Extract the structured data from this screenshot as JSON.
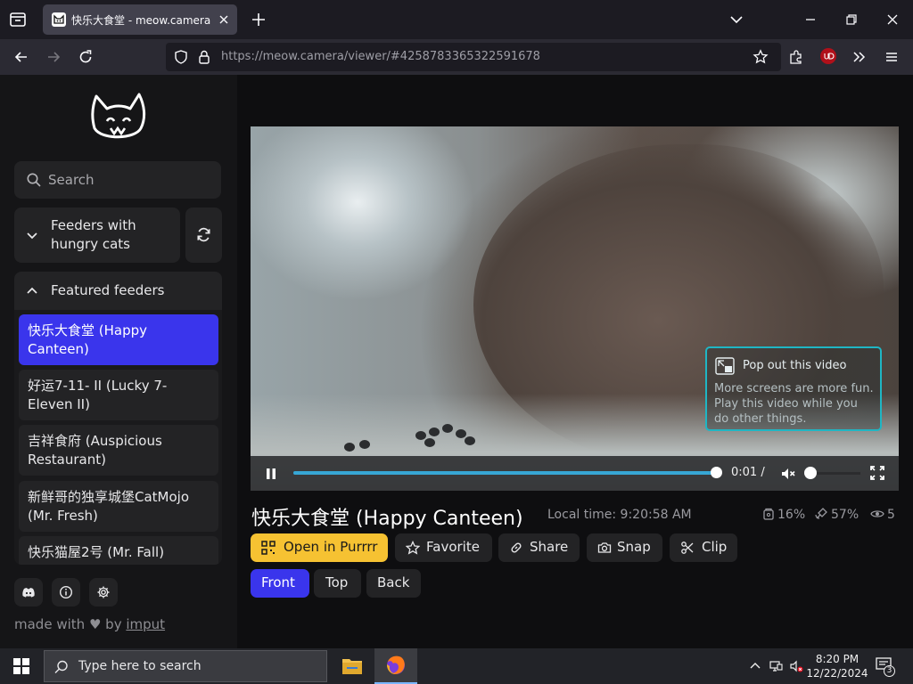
{
  "browser": {
    "tab_title": "快乐大食堂 - meow.camera",
    "url_host": "https://meow.camera",
    "url_path": "/viewer/#4258783365322591678"
  },
  "sidebar": {
    "search_placeholder": "Search",
    "group_hungry_line1": "Feeders with",
    "group_hungry_line2": "hungry cats",
    "group_featured": "Featured feeders",
    "feeders": [
      {
        "name": "快乐大食堂 (Happy Canteen)",
        "active": true
      },
      {
        "name": "好运7-11- II (Lucky 7-Eleven II)",
        "active": false
      },
      {
        "name": "吉祥食府 (Auspicious Restaurant)",
        "active": false
      },
      {
        "name": "新鲜哥的独享城堡CatMojo (Mr. Fresh)",
        "active": false
      },
      {
        "name": "快乐猫屋2号 (Mr. Fall)",
        "active": false
      }
    ],
    "made_with_prefix": "made with",
    "made_with_by": "by",
    "made_with_link": "imput"
  },
  "player": {
    "popout_title": "Pop out this video",
    "popout_desc": "More screens are more fun. Play this video while you do other things.",
    "time": "0:01 /",
    "progress": 1.0
  },
  "info": {
    "cam_title": "快乐大食堂 (Happy Canteen)",
    "local_time": "Local time: 9:20:58 AM",
    "stat_food": "16%",
    "stat_signal": "57%",
    "stat_viewers": "5"
  },
  "actions": {
    "open_purrrr": "Open in Purrrr",
    "favorite": "Favorite",
    "share": "Share",
    "snap": "Snap",
    "clip": "Clip"
  },
  "views": {
    "front": "Front",
    "top": "Top",
    "back": "Back"
  },
  "taskbar": {
    "search_placeholder": "Type here to search",
    "time": "8:20 PM",
    "date": "12/22/2024",
    "notifications": "3"
  },
  "colors": {
    "accent": "#3a35ec",
    "yellow": "#f6c232",
    "progress": "#37a7d5",
    "popout_border": "#1fb6c4"
  }
}
